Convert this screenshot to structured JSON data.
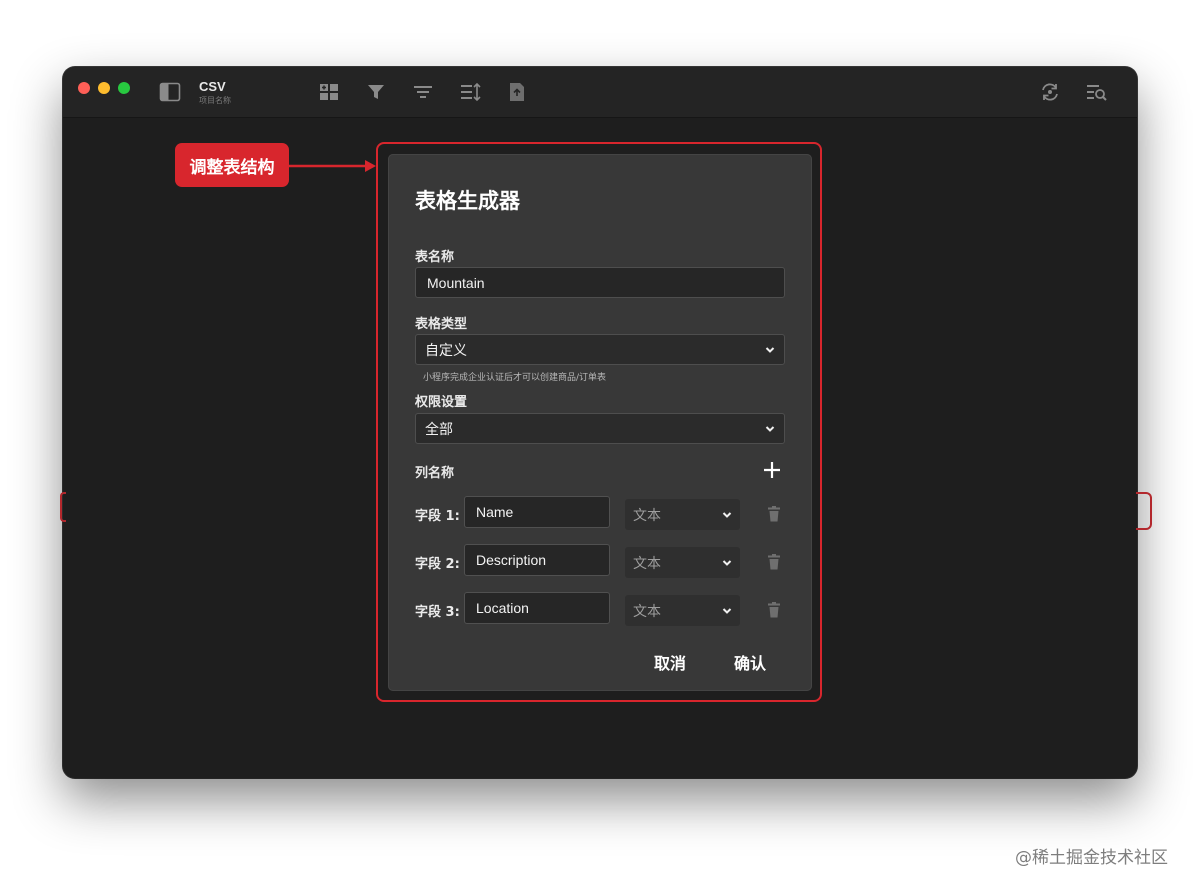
{
  "window": {
    "app_title": "CSV",
    "app_subtitle": "项目名称",
    "toolbar_icons": [
      "sidebar-toggle-icon",
      "add-table-icon",
      "filter-icon",
      "group-icon",
      "sort-icon",
      "export-icon",
      "sync-icon",
      "search-list-icon"
    ]
  },
  "annotation": {
    "callout_text": "调整表结构",
    "color": "#d8262d"
  },
  "dialog": {
    "title": "表格生成器",
    "table_name": {
      "label": "表名称",
      "value": "Mountain"
    },
    "table_type": {
      "label": "表格类型",
      "value": "自定义",
      "hint": "小程序完成企业认证后才可以创建商品/订单表"
    },
    "permission": {
      "label": "权限设置",
      "value": "全部"
    },
    "columns_label": "列名称",
    "fields": [
      {
        "label": "字段 1:",
        "name": "Name",
        "type": "文本"
      },
      {
        "label": "字段 2:",
        "name": "Description",
        "type": "文本"
      },
      {
        "label": "字段 3:",
        "name": "Location",
        "type": "文本"
      }
    ],
    "cancel_label": "取消",
    "confirm_label": "确认"
  },
  "watermark": "@稀土掘金技术社区"
}
